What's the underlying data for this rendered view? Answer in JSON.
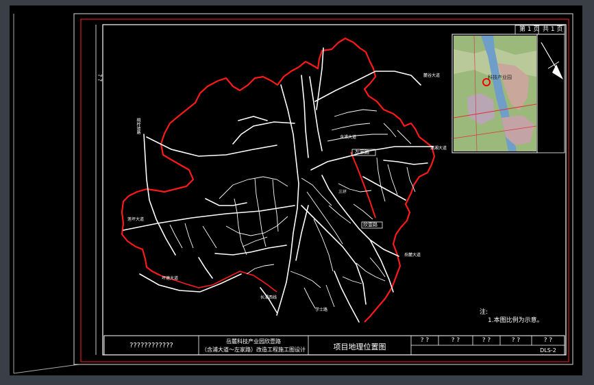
{
  "sheet": {
    "page_label": "第 1 页",
    "total_label": "共 1 页",
    "side_label": "? ?",
    "note_title": "注:",
    "note_line": "1.本图比例为示意。",
    "drawing_no": "DLS-2"
  },
  "titleblock": {
    "company": "????????????",
    "project_line1": "岳麓科技产业园欣壹路",
    "project_line2": "（含浦大道～左家路）改造工程施工图设计",
    "drawing_title": "项目地理位置图",
    "cells": [
      "? ?",
      "? ?",
      "? ?",
      "? ?",
      "? ?"
    ]
  },
  "map_labels": {
    "label_a": "左家路",
    "label_b": "欣壹路",
    "label_c": "含浦大道",
    "label_d": "莲坪大道",
    "label_e": "三环",
    "label_f": "岳麓大道",
    "label_g": "潇湘大道",
    "label_h": "坪塘大道",
    "label_i": "学士路",
    "label_j": "麓谷大道",
    "label_k": "长潭西线",
    "label_l": "桐梓坡路"
  },
  "inset": {
    "marker_label": "科技产业园"
  },
  "colors": {
    "background": "#000000",
    "frame": "#ffffff",
    "red_boundary": "#ff1a1a",
    "roads": "#ffffff"
  }
}
